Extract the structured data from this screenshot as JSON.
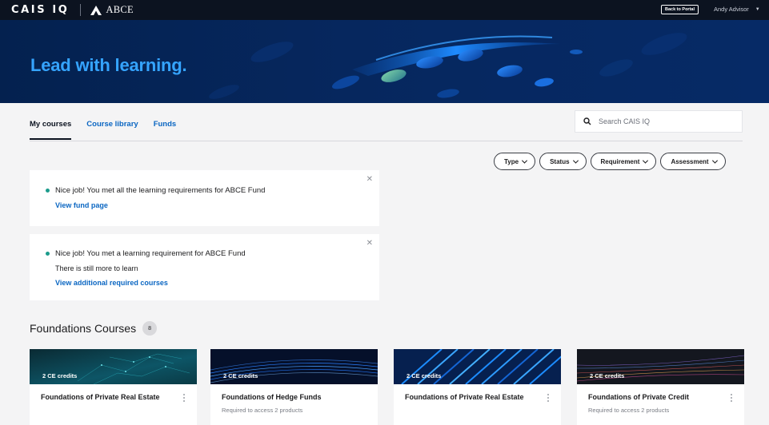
{
  "topbar": {
    "brand": "CAIS IQ",
    "partner": "ABCE",
    "back_button": "Back to Portal",
    "user": "Andy Advisor"
  },
  "hero": {
    "title": "Lead with learning."
  },
  "tabs": [
    {
      "label": "My courses",
      "active": true
    },
    {
      "label": "Course library",
      "active": false
    },
    {
      "label": "Funds",
      "active": false
    }
  ],
  "search": {
    "placeholder": "Search CAIS IQ",
    "value": ""
  },
  "filters": [
    "Type",
    "Status",
    "Requirement",
    "Assessment"
  ],
  "notifications": [
    {
      "message": "Nice job! You met all the learning requirements for ABCE Fund",
      "link": "View fund page"
    },
    {
      "message": "Nice job! You met a learning requirement for ABCE Fund",
      "sub": "There is still more to learn",
      "link": "View additional required courses"
    }
  ],
  "section": {
    "title": "Foundations Courses",
    "count": "8"
  },
  "cards": [
    {
      "credits": "2 CE credits",
      "title": "Foundations of Private Real Estate",
      "requirement": ""
    },
    {
      "credits": "2 CE credits",
      "title": "Foundations of Hedge Funds",
      "requirement": "Required to access 2 products"
    },
    {
      "credits": "2 CE credits",
      "title": "Foundations of Private Real Estate",
      "requirement": ""
    },
    {
      "credits": "2 CE credits",
      "title": "Foundations of Private Credit",
      "requirement": "Required to access 2 products"
    }
  ],
  "colors": {
    "topbar": "#0c1320",
    "hero_bg": "#04214f",
    "hero_title": "#35a4ff",
    "link": "#0a66c2",
    "status_dot": "#1c9c8c"
  }
}
